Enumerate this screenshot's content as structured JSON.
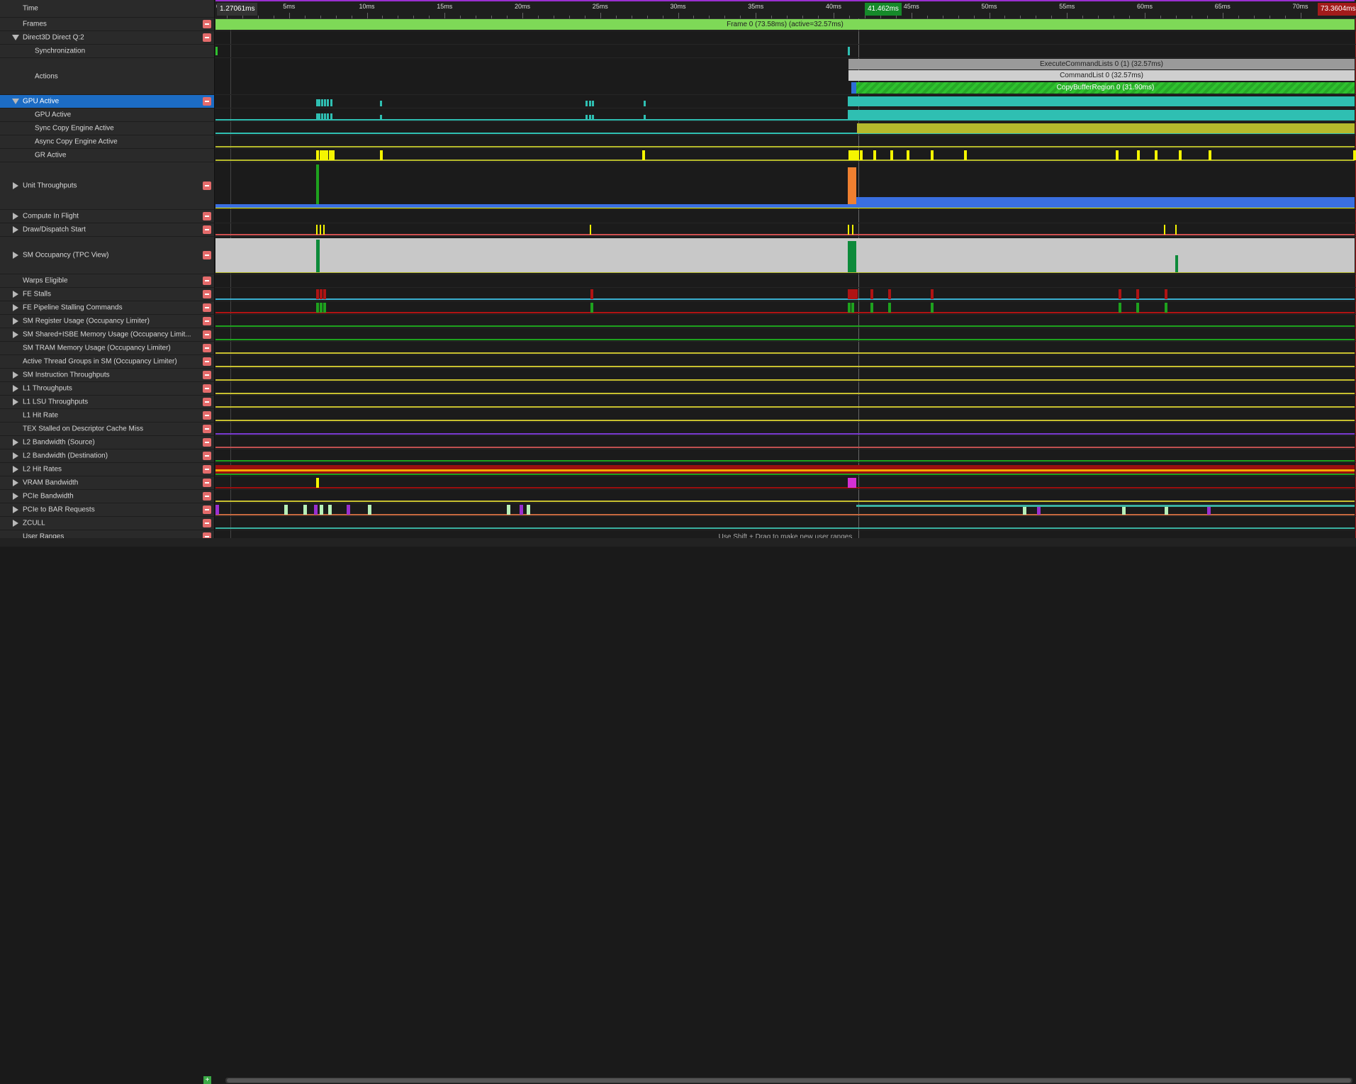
{
  "colors": {
    "accent": "#1c6cc4",
    "frame_bar": "#7ed957",
    "execute_bar": "#9a9a9a",
    "commandlist_bar": "#cfcfcf",
    "copy_bar": "#2fc12f",
    "gpu_teal": "#2fbfb2",
    "sync_yellow": "#b5b92c",
    "gr_yellow": "#f5f500",
    "throughput_blue": "#3a6fe0",
    "sm_occ_gray": "#c8c8c8",
    "sm_occ_green": "#0d8a3a",
    "fe_red": "#b01313",
    "fe_green": "#1ea21e",
    "l2_red": "#9a0f0f",
    "pcie_purple": "#9a2fd0",
    "pcie_lightgreen": "#b8f0b8"
  },
  "ruler": {
    "origin": "0",
    "start_marker": "1.27061ms",
    "cursor_marker": "41.462ms",
    "end_marker": "73.3604ms",
    "ticks": [
      "5ms",
      "10ms",
      "15ms",
      "20ms",
      "25ms",
      "30ms",
      "35ms",
      "40ms",
      "45ms",
      "50ms",
      "55ms",
      "60ms",
      "65ms",
      "70ms"
    ]
  },
  "rows": [
    {
      "label": "Time",
      "indent": false,
      "arrow": "none",
      "button": false
    },
    {
      "label": "Frames",
      "indent": false,
      "arrow": "none",
      "button": true
    },
    {
      "label": "Direct3D Direct Q:2",
      "indent": false,
      "arrow": "down",
      "button": true
    },
    {
      "label": "Synchronization",
      "indent": true,
      "arrow": "none",
      "button": false
    },
    {
      "label": "Actions",
      "indent": true,
      "arrow": "none",
      "button": false
    },
    {
      "label": "GPU Active",
      "indent": false,
      "arrow": "down",
      "button": true,
      "selected": true
    },
    {
      "label": "GPU Active",
      "indent": true,
      "arrow": "none",
      "button": false
    },
    {
      "label": "Sync Copy Engine Active",
      "indent": true,
      "arrow": "none",
      "button": false
    },
    {
      "label": "Async Copy Engine Active",
      "indent": true,
      "arrow": "none",
      "button": false
    },
    {
      "label": "GR Active",
      "indent": true,
      "arrow": "none",
      "button": false
    },
    {
      "label": "Unit Throughputs",
      "indent": false,
      "arrow": "right",
      "button": true
    },
    {
      "label": "Compute In Flight",
      "indent": false,
      "arrow": "right",
      "button": true
    },
    {
      "label": "Draw/Dispatch Start",
      "indent": false,
      "arrow": "right",
      "button": true
    },
    {
      "label": "SM Occupancy (TPC View)",
      "indent": false,
      "arrow": "right",
      "button": true
    },
    {
      "label": "Warps Eligible",
      "indent": false,
      "arrow": "none",
      "button": true
    },
    {
      "label": "FE Stalls",
      "indent": false,
      "arrow": "right",
      "button": true
    },
    {
      "label": "FE Pipeline Stalling Commands",
      "indent": false,
      "arrow": "right",
      "button": true
    },
    {
      "label": "SM Register Usage (Occupancy Limiter)",
      "indent": false,
      "arrow": "right",
      "button": true
    },
    {
      "label": "SM Shared+ISBE Memory Usage (Occupancy Limit...",
      "indent": false,
      "arrow": "right",
      "button": true
    },
    {
      "label": "SM TRAM Memory Usage (Occupancy Limiter)",
      "indent": false,
      "arrow": "none",
      "button": true
    },
    {
      "label": "Active Thread Groups in SM (Occupancy Limiter)",
      "indent": false,
      "arrow": "none",
      "button": true
    },
    {
      "label": "SM Instruction Throughputs",
      "indent": false,
      "arrow": "right",
      "button": true
    },
    {
      "label": "L1 Throughputs",
      "indent": false,
      "arrow": "right",
      "button": true
    },
    {
      "label": "L1 LSU Throughputs",
      "indent": false,
      "arrow": "right",
      "button": true
    },
    {
      "label": "L1 Hit Rate",
      "indent": false,
      "arrow": "none",
      "button": true
    },
    {
      "label": "TEX Stalled on Descriptor Cache Miss",
      "indent": false,
      "arrow": "none",
      "button": true
    },
    {
      "label": "L2 Bandwidth (Source)",
      "indent": false,
      "arrow": "right",
      "button": true
    },
    {
      "label": "L2 Bandwidth (Destination)",
      "indent": false,
      "arrow": "right",
      "button": true
    },
    {
      "label": "L2 Hit Rates",
      "indent": false,
      "arrow": "right",
      "button": true
    },
    {
      "label": "VRAM Bandwidth",
      "indent": false,
      "arrow": "right",
      "button": true
    },
    {
      "label": "PCIe Bandwidth",
      "indent": false,
      "arrow": "right",
      "button": true
    },
    {
      "label": "PCIe to BAR Requests",
      "indent": false,
      "arrow": "right",
      "button": true
    },
    {
      "label": "ZCULL",
      "indent": false,
      "arrow": "right",
      "button": true
    },
    {
      "label": "User Ranges",
      "indent": false,
      "arrow": "none",
      "button": true
    }
  ],
  "bars": {
    "frame": "Frame 0 (73.58ms) (active=32.57ms)",
    "execute": "ExecuteCommandLists 0 (1) (32.57ms)",
    "commandlist": "CommandList 0 (32.57ms)",
    "copy": "CopyBufferRegion 0 (31.90ms)"
  },
  "user_ranges_hint": "Use Shift + Drag to make new user ranges",
  "add_button": "+"
}
